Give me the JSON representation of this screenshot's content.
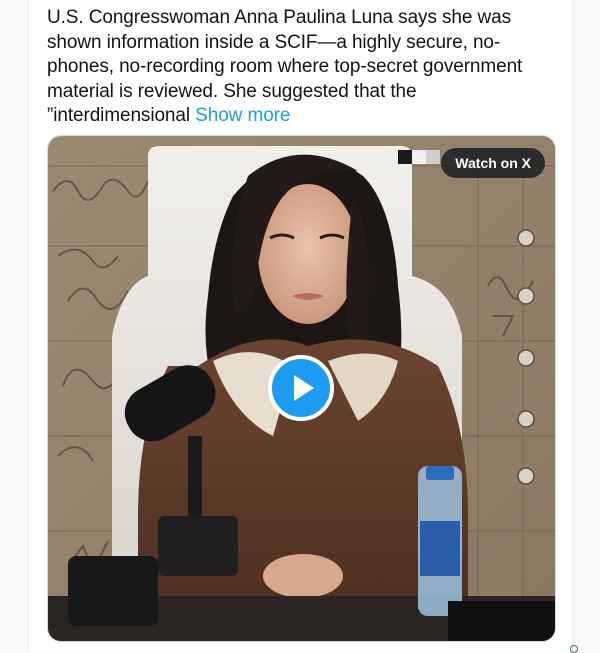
{
  "tweet": {
    "text": "U.S. Congresswoman Anna Paulina Luna says she was shown information inside a SCIF—a highly secure, no-phones, no-recording room where top-secret government material is reviewed. She suggested that the ”interdimensional",
    "show_more_label": "Show more"
  },
  "media": {
    "watch_label": "Watch on X",
    "play_icon": "play-icon",
    "accent_color": "#1d9bf0"
  }
}
